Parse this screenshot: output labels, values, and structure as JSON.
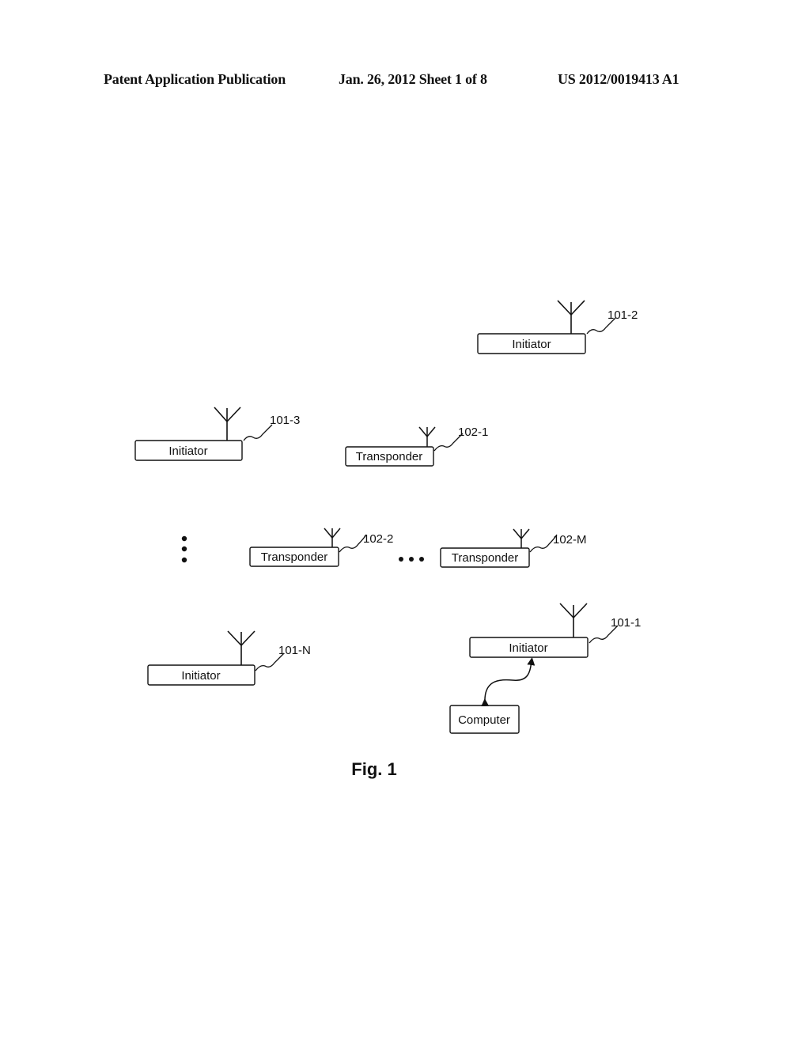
{
  "header": {
    "publication": "Patent Application Publication",
    "date_sheet": "Jan. 26, 2012   Sheet 1 of 8",
    "number": "US 2012/0019413 A1"
  },
  "figure": {
    "caption": "Fig. 1",
    "nodes": [
      {
        "id": "101-2",
        "label": "Initiator",
        "ref": "101-2",
        "kind": "initiator"
      },
      {
        "id": "101-3",
        "label": "Initiator",
        "ref": "101-3",
        "kind": "initiator"
      },
      {
        "id": "102-1",
        "label": "Transponder",
        "ref": "102-1",
        "kind": "transponder"
      },
      {
        "id": "102-2",
        "label": "Transponder",
        "ref": "102-2",
        "kind": "transponder"
      },
      {
        "id": "102-M",
        "label": "Transponder",
        "ref": "102-M",
        "kind": "transponder"
      },
      {
        "id": "101-N",
        "label": "Initiator",
        "ref": "101-N",
        "kind": "initiator"
      },
      {
        "id": "101-1",
        "label": "Initiator",
        "ref": "101-1",
        "kind": "initiator"
      },
      {
        "id": "computer",
        "label": "Computer",
        "kind": "computer"
      }
    ],
    "edges": [
      {
        "from": "101-1",
        "to": "computer",
        "type": "bidirectional"
      }
    ],
    "ellipses": [
      "vertical",
      "horizontal"
    ]
  }
}
